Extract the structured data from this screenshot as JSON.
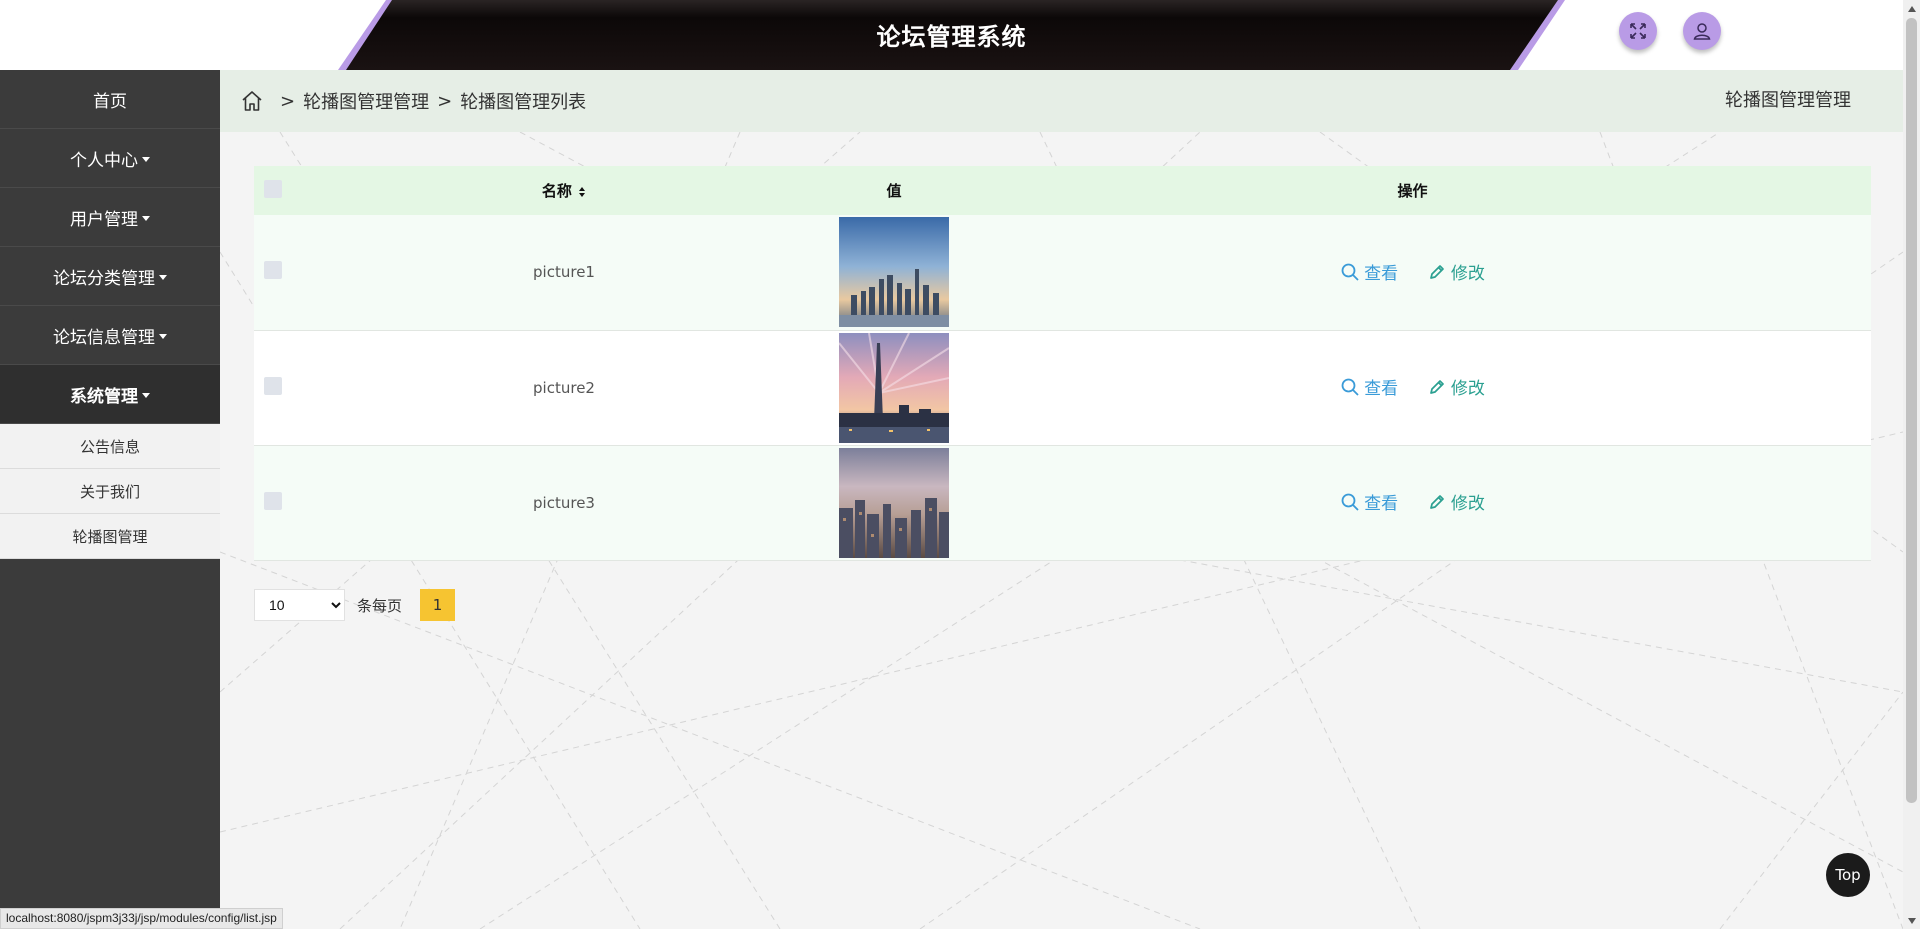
{
  "header": {
    "title": "论坛管理系统",
    "fullscreen_icon": "expand-icon",
    "user_icon": "user-icon"
  },
  "sidebar": {
    "items": [
      {
        "label": "首页",
        "has_caret": false
      },
      {
        "label": "个人中心",
        "has_caret": true
      },
      {
        "label": "用户管理",
        "has_caret": true
      },
      {
        "label": "论坛分类管理",
        "has_caret": true
      },
      {
        "label": "论坛信息管理",
        "has_caret": true
      },
      {
        "label": "系统管理",
        "has_caret": true,
        "active": true
      }
    ],
    "sub_items": [
      {
        "label": "公告信息"
      },
      {
        "label": "关于我们"
      },
      {
        "label": "轮播图管理"
      }
    ]
  },
  "breadcrumb": {
    "sep": ">",
    "level1": "轮播图管理管理",
    "level2": "轮播图管理列表",
    "right_title": "轮播图管理管理"
  },
  "table": {
    "headers": {
      "name": "名称",
      "value": "值",
      "actions": "操作"
    },
    "rows": [
      {
        "name": "picture1",
        "image": "city-skyline-dusk"
      },
      {
        "name": "picture2",
        "image": "tower-pink-sky"
      },
      {
        "name": "picture3",
        "image": "city-buildings-cloudy"
      }
    ],
    "action_view": "查看",
    "action_edit": "修改"
  },
  "pagination": {
    "page_size": "10",
    "page_size_options": [
      "10"
    ],
    "per_page_label": "条每页",
    "current_page": "1"
  },
  "top_button": "Top",
  "status_url": "localhost:8080/jspm3j33j/jsp/modules/config/list.jsp",
  "colors": {
    "sidebar_bg": "#3b3b3b",
    "header_bg": "#120c0c",
    "header_accent": "#b99be6",
    "table_header_bg": "#e4f7e4",
    "view_link": "#3a9bd8",
    "edit_link": "#2ba091",
    "page_active": "#f6c431"
  }
}
